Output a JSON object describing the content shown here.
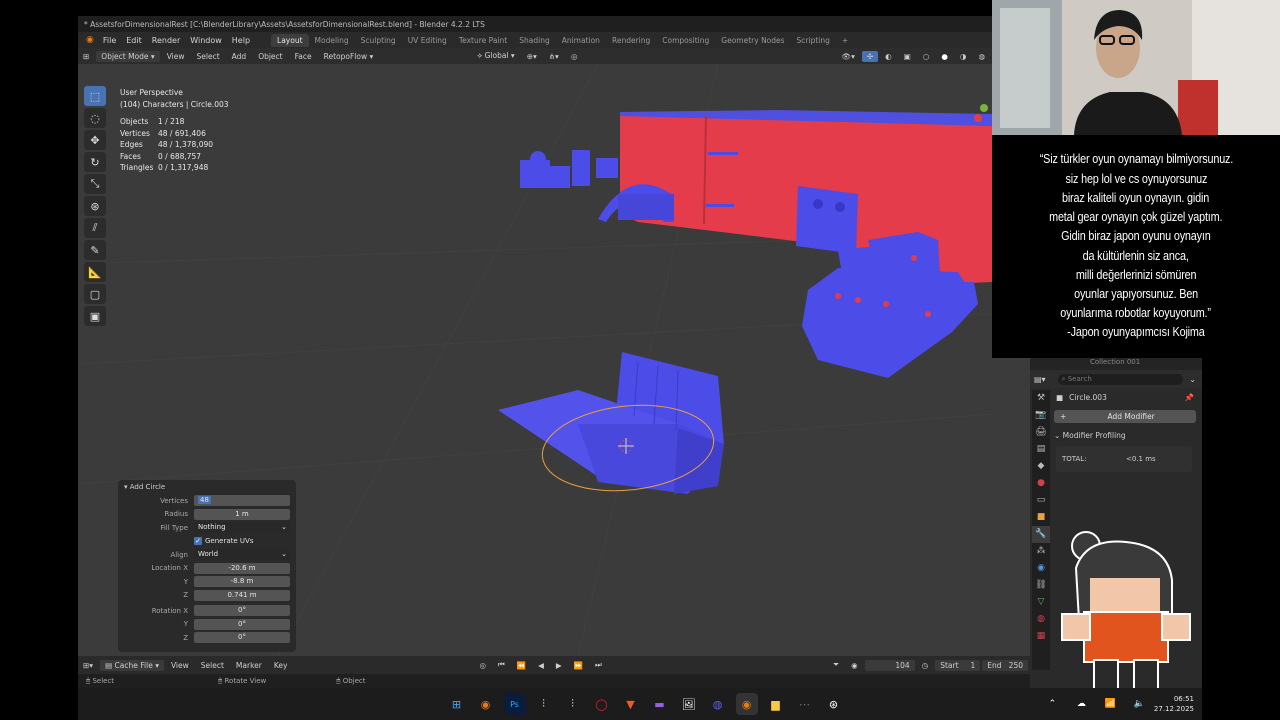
{
  "window": {
    "title": "* AssetsforDimensionalRest [C:\\BlenderLibrary\\Assets\\AssetsforDimensionalRest.blend] - Blender 4.2.2 LTS"
  },
  "menu": {
    "items": [
      "File",
      "Edit",
      "Render",
      "Window",
      "Help"
    ]
  },
  "workspaces": {
    "tabs": [
      "Layout",
      "Modeling",
      "Sculpting",
      "UV Editing",
      "Texture Paint",
      "Shading",
      "Animation",
      "Rendering",
      "Compositing",
      "Geometry Nodes",
      "Scripting"
    ],
    "add": "+"
  },
  "header": {
    "mode": "Object Mode",
    "view": "View",
    "select": "Select",
    "add": "Add",
    "object": "Object",
    "face": "Face",
    "retopo": "RetopoFlow",
    "orientation": "Global"
  },
  "overlay": {
    "perspective": "User Perspective",
    "collection": "(104) Characters | Circle.003",
    "stats": [
      {
        "label": "Objects",
        "value": "1 / 218"
      },
      {
        "label": "Vertices",
        "value": "48 / 691,406"
      },
      {
        "label": "Edges",
        "value": "48 / 1,378,090"
      },
      {
        "label": "Faces",
        "value": "0 / 688,757"
      },
      {
        "label": "Triangles",
        "value": "0 / 1,317,948"
      }
    ]
  },
  "tools": [
    "select-box-icon",
    "cursor-icon",
    "move-icon",
    "rotate-icon",
    "scale-icon",
    "transform-icon",
    "annotate-icon",
    "draw-icon",
    "measure-icon",
    "add-cube-icon",
    "add-cube-alt-icon"
  ],
  "operator": {
    "title": "Add Circle",
    "vertices_label": "Vertices",
    "vertices": "48",
    "radius_label": "Radius",
    "radius": "1 m",
    "fill_label": "Fill Type",
    "fill": "Nothing",
    "uvs_label": "Generate UVs",
    "align_label": "Align",
    "align": "World",
    "loc_label": "Location X",
    "loc_x": "-20.6 m",
    "loc_y_label": "Y",
    "loc_y": "-8.8 m",
    "loc_z_label": "Z",
    "loc_z": "0.741 m",
    "rot_label": "Rotation X",
    "rot_x": "0°",
    "rot_y_label": "Y",
    "rot_y": "0°",
    "rot_z_label": "Z",
    "rot_z": "0°"
  },
  "timeline": {
    "cache": "Cache File",
    "view": "View",
    "select": "Select",
    "marker": "Marker",
    "key": "Key",
    "current": "104",
    "start_label": "Start",
    "start": "1",
    "end_label": "End",
    "end": "250"
  },
  "status": {
    "select": "Select",
    "rotate": "Rotate View",
    "object": "Object"
  },
  "properties": {
    "search": "Search",
    "object": "Circle.003",
    "add_modifier": "Add Modifier",
    "profiling": "Modifier Profiling",
    "total_label": "TOTAL:",
    "total": "<0.1 ms",
    "outliner_item": "Collection 001"
  },
  "quote": {
    "lines": [
      "“Siz türkler oyun oynamayı bilmiyorsunuz.",
      "siz hep lol ve cs oynuyorsunuz",
      "biraz kaliteli oyun oynayın. gidin",
      "metal gear oynayın çok güzel yaptım.",
      "Gidin biraz japon oyunu oynayın",
      "da kültürlenin siz anca,",
      "milli değerlerinizi sömüren",
      "oyunlar yapıyorsunuz. Ben",
      "oyunlarıma robotlar koyuyorum.”",
      "-Japon oyunyapımcısı Kojima"
    ]
  },
  "taskbar": {
    "time": "06:51",
    "date": "27.12.2025",
    "version": "4.2.2"
  },
  "colors": {
    "blue": "#4c4ce8",
    "red": "#e43c4a",
    "accent": "#4772b3"
  }
}
